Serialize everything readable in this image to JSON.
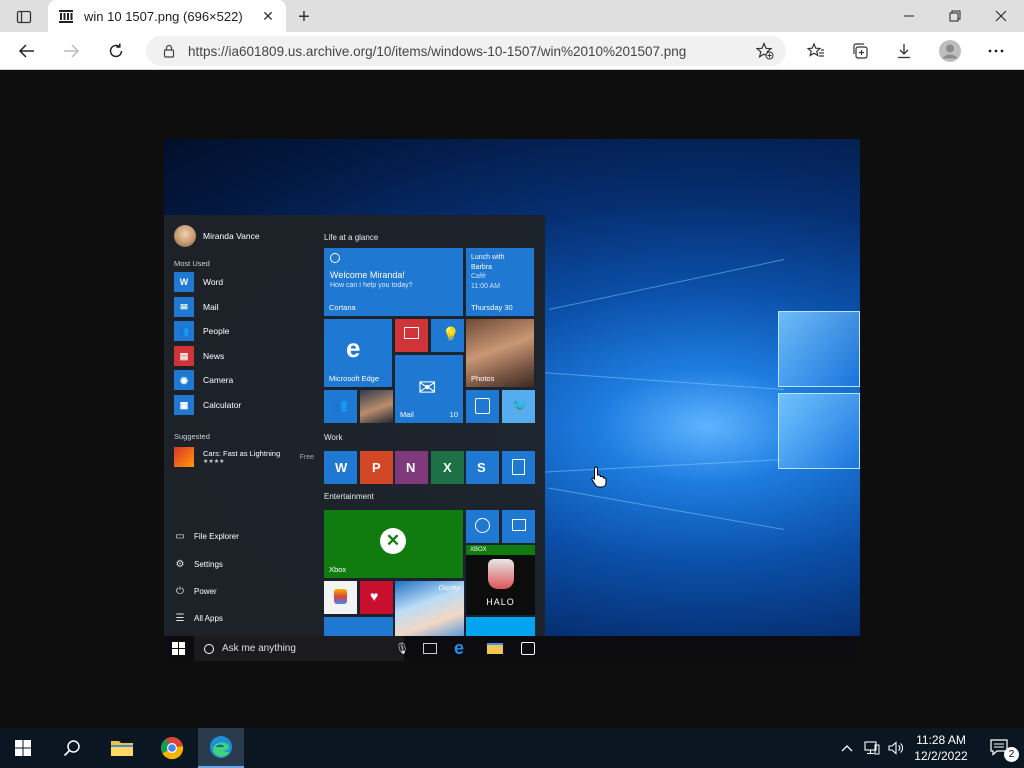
{
  "browser": {
    "tab": {
      "title": "win 10 1507.png (696×522)"
    },
    "address": {
      "url": "https://ia601809.us.archive.org/10/items/windows-10-1507/win%2010%201507.png"
    }
  },
  "screenshot": {
    "user_name": "Miranda Vance",
    "most_used_heading": "Most Used",
    "apps": [
      {
        "label": "Word",
        "icon": "word-icon"
      },
      {
        "label": "Mail",
        "icon": "mail-icon"
      },
      {
        "label": "People",
        "icon": "people-icon"
      },
      {
        "label": "News",
        "icon": "news-icon"
      },
      {
        "label": "Camera",
        "icon": "camera-icon"
      },
      {
        "label": "Calculator",
        "icon": "calculator-icon"
      }
    ],
    "suggested_heading": "Suggested",
    "suggested_app": {
      "label": "Cars: Fast as Lightning",
      "price": "Free",
      "stars": "★★★★"
    },
    "system_items": [
      {
        "label": "File Explorer",
        "icon": "folder-icon"
      },
      {
        "label": "Settings",
        "icon": "gear-icon"
      },
      {
        "label": "Power",
        "icon": "power-icon"
      },
      {
        "label": "All Apps",
        "icon": "list-icon"
      }
    ],
    "groups": {
      "life": "Life at a glance",
      "work": "Work",
      "entertainment": "Entertainment"
    },
    "tiles": {
      "cortana_title": "Welcome Miranda!",
      "cortana_sub": "How can I help you today?",
      "cortana_label": "Cortana",
      "calendar_line1": "Lunch with",
      "calendar_line2": "Barbra",
      "calendar_line3": "Café",
      "calendar_line4": "11:00 AM",
      "calendar_day": "Thursday 30",
      "edge_label": "Microsoft Edge",
      "photos_label": "Photos",
      "mail_label": "Mail",
      "mail_count": "10",
      "xbox_label": "Xbox",
      "xbox_badge": "XBOX",
      "halo_label": "HALO",
      "disney_label": "Disney"
    },
    "search_placeholder": "Ask me anything"
  },
  "taskbar": {
    "time": "11:28 AM",
    "date": "12/2/2022",
    "notification_count": "2"
  },
  "colors": {
    "accent": "#1f78d1",
    "xbox": "#107c10",
    "taskbar": "#0a1622"
  }
}
